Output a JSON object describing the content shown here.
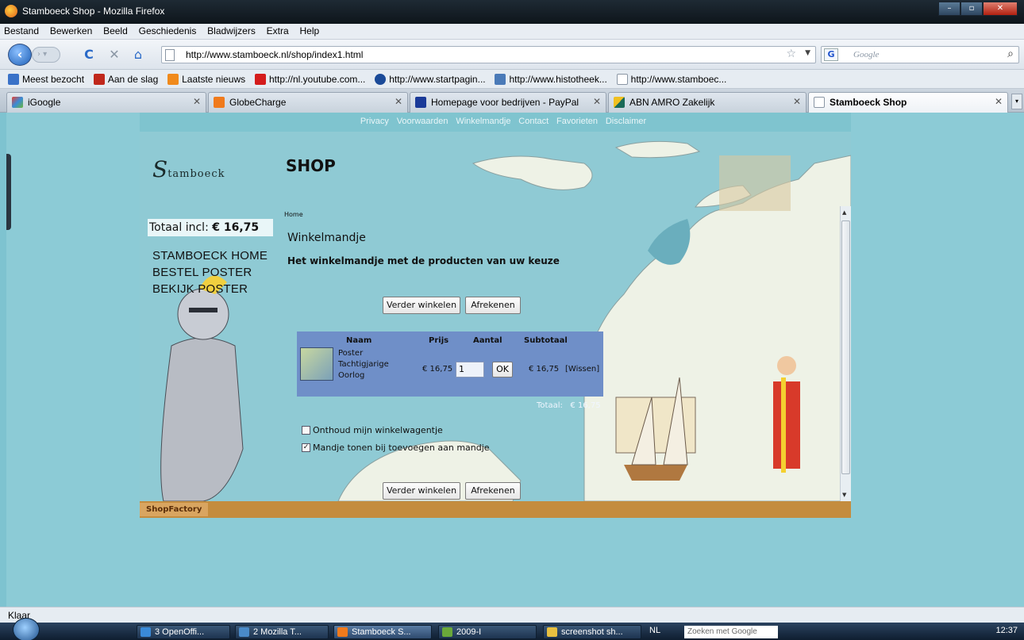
{
  "window": {
    "title": "Stamboeck Shop - Mozilla Firefox",
    "controls": {
      "minimize": "–",
      "maximize": "▫",
      "close": "✕"
    }
  },
  "menu": [
    "Bestand",
    "Bewerken",
    "Beeld",
    "Geschiedenis",
    "Bladwijzers",
    "Extra",
    "Help"
  ],
  "toolbar": {
    "url": "http://www.stamboeck.nl/shop/index1.html",
    "search_placeholder": "Google",
    "search_engine_icon": "G"
  },
  "bookmarks": [
    {
      "label": "Meest bezocht",
      "color": "#3a72c8"
    },
    {
      "label": "Aan de slag",
      "color": "#c0281c"
    },
    {
      "label": "Laatste nieuws",
      "color": "#f08a1c"
    },
    {
      "label": "http://nl.youtube.com...",
      "color": "#d41c1c"
    },
    {
      "label": "http://www.startpagin...",
      "color": "#1a4a98"
    },
    {
      "label": "http://www.histotheek...",
      "color": "#4a7ab8"
    },
    {
      "label": "http://www.stamboec...",
      "color": "#ffffff"
    }
  ],
  "tabs": [
    {
      "label": "iGoogle",
      "color": "#3a8ad8",
      "active": false
    },
    {
      "label": "GlobeCharge",
      "color": "#f07a1c",
      "active": false
    },
    {
      "label": "Homepage voor bedrijven - PayPal",
      "color": "#1a3a98",
      "active": false
    },
    {
      "label": "ABN AMRO Zakelijk",
      "color": "#1a6a58",
      "active": false
    },
    {
      "label": "Stamboeck Shop",
      "color": "#ffffff",
      "active": true
    }
  ],
  "site": {
    "topnav": [
      "Privacy",
      "Voorwaarden",
      "Winkelmandje",
      "Contact",
      "Favorieten",
      "Disclaimer"
    ],
    "logo_initial": "S",
    "logo_rest": "tamboeck",
    "shop_title": "SHOP",
    "total_label": "Totaal incl:",
    "total_value": "€ 16,75",
    "side_menu": [
      "STAMBOECK HOME",
      "BESTEL POSTER",
      "BEKIJK POSTER"
    ],
    "breadcrumb": "Home",
    "heading": "Winkelmandje",
    "subheading": "Het winkelmandje met de producten van uw keuze",
    "continue_btn": "Verder winkelen",
    "checkout_btn": "Afrekenen",
    "cart": {
      "headers": {
        "name": "Naam",
        "price": "Prijs",
        "qty": "Aantal",
        "subtotal": "Subtotaal"
      },
      "item": {
        "name_line1": "Poster",
        "name_line2": "Tachtigjarige",
        "name_line3": "Oorlog",
        "price": "€ 16,75",
        "qty": "1",
        "ok": "OK",
        "subtotal": "€ 16,75",
        "remove": "[Wissen]"
      },
      "total_label": "Totaal:",
      "total_value": "€ 16,75"
    },
    "options": [
      {
        "label": "Onthoud mijn winkelwagentje",
        "checked": false
      },
      {
        "label": "Mandje tonen bij toevoegen aan mandje",
        "checked": true
      }
    ],
    "footer_label": "ShopFactory"
  },
  "status": "Klaar",
  "taskbar": {
    "tasks": [
      {
        "label": "3 OpenOffi...",
        "color": "#3a8ad8"
      },
      {
        "label": "2 Mozilla T...",
        "color": "#4a8ac8"
      },
      {
        "label": "Stamboeck S...",
        "color": "#f07a1c"
      },
      {
        "label": "2009-I",
        "color": "#6aa83a"
      },
      {
        "label": "screenshot sh...",
        "color": "#e8c040"
      }
    ],
    "language": "NL",
    "search_placeholder": "Zoeken met Google",
    "clock": "12:37"
  }
}
